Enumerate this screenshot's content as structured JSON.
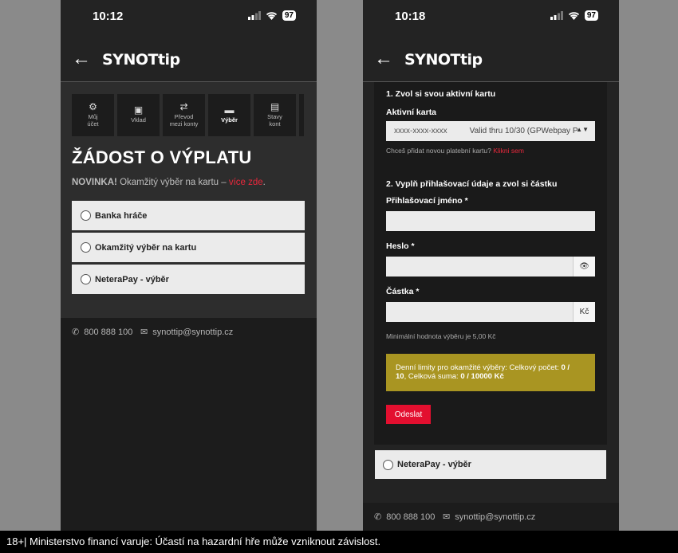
{
  "left": {
    "time": "10:12",
    "battery": "97",
    "logo": "SYNOTtip",
    "tabs": [
      {
        "icon": "gear-icon",
        "label_1": "Můj",
        "label_2": "účet",
        "glyph": "⚙"
      },
      {
        "icon": "cash-icon",
        "label_1": "Vklad",
        "label_2": "",
        "glyph": "▣"
      },
      {
        "icon": "transfer-icon",
        "label_1": "Převod",
        "label_2": "mezi konty",
        "glyph": "⇄"
      },
      {
        "icon": "card-icon",
        "label_1": "Výběr",
        "label_2": "",
        "glyph": "▬"
      },
      {
        "icon": "account-state-icon",
        "label_1": "Stavy",
        "label_2": "kont",
        "glyph": "▤"
      }
    ],
    "title": "ŽÁDOST O VÝPLATU",
    "novinka_bold": "NOVINKA!",
    "novinka_text": " Okamžitý výběr na kartu – ",
    "novinka_link": "více zde",
    "novinka_end": ".",
    "options": [
      "Banka hráče",
      "Okamžitý výběr na kartu",
      "NeteraPay - výběr"
    ],
    "phone": "800 888 100",
    "email": "synottip@synottip.cz"
  },
  "right": {
    "time": "10:18",
    "battery": "97",
    "logo": "SYNOTtip",
    "step1": "1. Zvol si svou aktivní kartu",
    "active_card_label": "Aktivní karta",
    "card_number": "xxxx-xxxx-xxxx",
    "card_valid": "Valid thru 10/30 (GPWebpay P",
    "add_card_text": "Chceš přidat novou platební kartu? ",
    "add_card_link": "Klikni sem",
    "step2": "2. Vyplň přihlašovací údaje a zvol si částku",
    "login_label": "Přihlašovací jméno *",
    "password_label": "Heslo *",
    "amount_label": "Částka *",
    "currency": "Kč",
    "min_text": "Minimální hodnota výběru je 5,00 Kč",
    "limits_1": "Denní limity pro okamžité výběry: Celkový počet: ",
    "limits_2": "0 /",
    "limits_3": "10",
    "limits_4": ", Celková suma: ",
    "limits_5": "0 / 10000 Kč",
    "submit": "Odeslat",
    "option": "NeteraPay - výběr",
    "phone": "800 888 100",
    "email": "synottip@synottip.cz"
  },
  "warning": "18+| Ministerstvo financí varuje: Účastí na hazardní hře může vzniknout závislost."
}
